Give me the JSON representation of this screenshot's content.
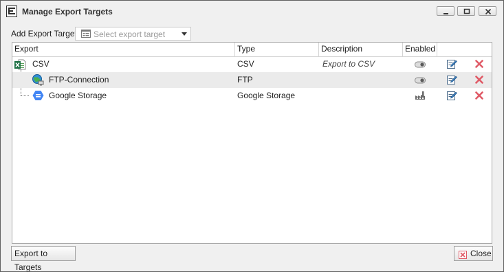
{
  "window": {
    "title": "Manage Export Targets"
  },
  "toolbar": {
    "add_label": "Add Export Target",
    "select_placeholder": "Select export target"
  },
  "grid": {
    "columns": [
      "Export",
      "Type",
      "Description",
      "Enabled"
    ],
    "rows": [
      {
        "name": "CSV",
        "type": "CSV",
        "description": "Export to CSV",
        "enabled_icon": "toggle-icon",
        "icon": "excel-csv-icon"
      },
      {
        "name": "FTP-Connection",
        "type": "FTP",
        "description": "",
        "enabled_icon": "toggle-icon",
        "icon": "globe-network-icon"
      },
      {
        "name": "Google Storage",
        "type": "Google Storage",
        "description": "",
        "enabled_icon": "factory-icon",
        "icon": "google-storage-icon"
      }
    ]
  },
  "footer": {
    "export_button": "Export to Targets",
    "close_button": "Close"
  },
  "colors": {
    "delete": "#e05a66",
    "alt_row": "#ebebeb",
    "window_bg": "#f0f0f0"
  }
}
